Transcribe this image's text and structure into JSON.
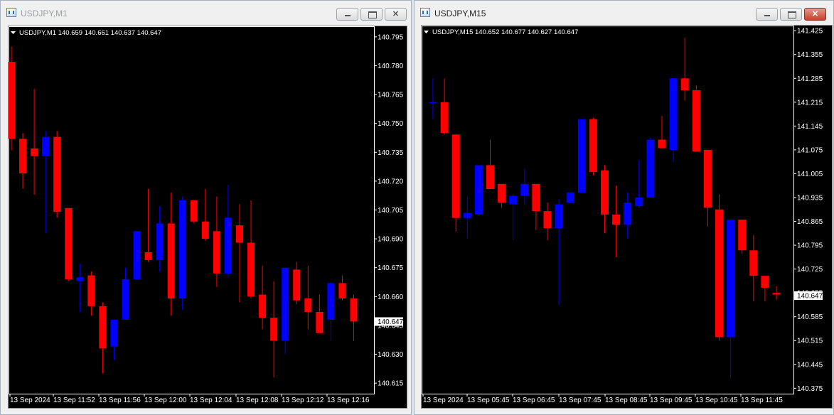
{
  "colors": {
    "bull": "#0000ff",
    "bear": "#ff0000",
    "background": "#000000",
    "axis_text": "#ffffff"
  },
  "windows": [
    {
      "title": "USDJPY,M1",
      "active": false,
      "info": "USDJPY,M1  140.659 140.661 140.637 140.647",
      "price_label": "140.647",
      "chart_data": {
        "type": "candlestick",
        "symbol": "USDJPY",
        "timeframe": "M1",
        "current_price": 140.647,
        "y_ticks": [
          "140.795",
          "140.780",
          "140.765",
          "140.750",
          "140.735",
          "140.720",
          "140.705",
          "140.690",
          "140.675",
          "140.660",
          "140.645",
          "140.630",
          "140.615"
        ],
        "ylim": [
          140.6095,
          140.8005
        ],
        "x_labels": [
          "13 Sep 2024",
          "13 Sep 11:52",
          "13 Sep 11:56",
          "13 Sep 12:00",
          "13 Sep 12:04",
          "13 Sep 12:08",
          "13 Sep 12:12",
          "13 Sep 12:16"
        ],
        "candles": [
          {
            "o": 140.782,
            "h": 140.79,
            "l": 140.736,
            "c": 140.742
          },
          {
            "o": 140.742,
            "h": 140.745,
            "l": 140.716,
            "c": 140.724
          },
          {
            "o": 140.737,
            "h": 140.768,
            "l": 140.713,
            "c": 140.733
          },
          {
            "o": 140.733,
            "h": 140.746,
            "l": 140.693,
            "c": 140.743
          },
          {
            "o": 140.743,
            "h": 140.746,
            "l": 140.701,
            "c": 140.704
          },
          {
            "o": 140.706,
            "h": 140.706,
            "l": 140.668,
            "c": 140.669
          },
          {
            "o": 140.668,
            "h": 140.677,
            "l": 140.652,
            "c": 140.67
          },
          {
            "o": 140.671,
            "h": 140.673,
            "l": 140.65,
            "c": 140.655
          },
          {
            "o": 140.655,
            "h": 140.657,
            "l": 140.62,
            "c": 140.633
          },
          {
            "o": 140.634,
            "h": 140.648,
            "l": 140.627,
            "c": 140.648
          },
          {
            "o": 140.648,
            "h": 140.675,
            "l": 140.648,
            "c": 140.669
          },
          {
            "o": 140.669,
            "h": 140.694,
            "l": 140.669,
            "c": 140.694
          },
          {
            "o": 140.683,
            "h": 140.716,
            "l": 140.678,
            "c": 140.679
          },
          {
            "o": 140.679,
            "h": 140.707,
            "l": 140.673,
            "c": 140.698
          },
          {
            "o": 140.698,
            "h": 140.714,
            "l": 140.65,
            "c": 140.659
          },
          {
            "o": 140.659,
            "h": 140.712,
            "l": 140.653,
            "c": 140.71
          },
          {
            "o": 140.71,
            "h": 140.71,
            "l": 140.698,
            "c": 140.699
          },
          {
            "o": 140.699,
            "h": 140.716,
            "l": 140.689,
            "c": 140.69
          },
          {
            "o": 140.694,
            "h": 140.712,
            "l": 140.665,
            "c": 140.672
          },
          {
            "o": 140.672,
            "h": 140.718,
            "l": 140.67,
            "c": 140.701
          },
          {
            "o": 140.697,
            "h": 140.708,
            "l": 140.657,
            "c": 140.688
          },
          {
            "o": 140.688,
            "h": 140.71,
            "l": 140.659,
            "c": 140.66
          },
          {
            "o": 140.661,
            "h": 140.676,
            "l": 140.643,
            "c": 140.649
          },
          {
            "o": 140.649,
            "h": 140.668,
            "l": 140.618,
            "c": 140.637
          },
          {
            "o": 140.637,
            "h": 140.672,
            "l": 140.63,
            "c": 140.675
          },
          {
            "o": 140.674,
            "h": 140.678,
            "l": 140.656,
            "c": 140.658
          },
          {
            "o": 140.659,
            "h": 140.676,
            "l": 140.643,
            "c": 140.652
          },
          {
            "o": 140.652,
            "h": 140.661,
            "l": 140.641,
            "c": 140.641
          },
          {
            "o": 140.648,
            "h": 140.666,
            "l": 140.637,
            "c": 140.667
          },
          {
            "o": 140.667,
            "h": 140.671,
            "l": 140.658,
            "c": 140.659
          },
          {
            "o": 140.659,
            "h": 140.661,
            "l": 140.637,
            "c": 140.647
          }
        ]
      }
    },
    {
      "title": "USDJPY,M15",
      "active": true,
      "info": "USDJPY,M15  140.652 140.677 140.627 140.647",
      "price_label": "140.647",
      "chart_data": {
        "type": "candlestick",
        "symbol": "USDJPY",
        "timeframe": "M15",
        "current_price": 140.647,
        "y_ticks": [
          "141.425",
          "141.355",
          "141.285",
          "141.215",
          "141.145",
          "141.075",
          "141.005",
          "140.935",
          "140.865",
          "140.795",
          "140.725",
          "140.655",
          "140.585",
          "140.515",
          "140.445",
          "140.375"
        ],
        "ylim": [
          140.359,
          141.44
        ],
        "x_labels": [
          "13 Sep 2024",
          "13 Sep 05:45",
          "13 Sep 06:45",
          "13 Sep 07:45",
          "13 Sep 08:45",
          "13 Sep 09:45",
          "13 Sep 10:45",
          "13 Sep 11:45"
        ],
        "candles": [
          {
            "o": 141.215,
            "h": 141.285,
            "l": 141.165,
            "c": 141.215
          },
          {
            "o": 141.215,
            "h": 141.285,
            "l": 141.12,
            "c": 141.125
          },
          {
            "o": 141.12,
            "h": 141.12,
            "l": 140.835,
            "c": 140.875
          },
          {
            "o": 140.875,
            "h": 140.94,
            "l": 140.815,
            "c": 140.89
          },
          {
            "o": 140.885,
            "h": 141.03,
            "l": 140.88,
            "c": 141.03
          },
          {
            "o": 141.03,
            "h": 141.105,
            "l": 140.96,
            "c": 140.96
          },
          {
            "o": 140.975,
            "h": 140.975,
            "l": 140.905,
            "c": 140.92
          },
          {
            "o": 140.915,
            "h": 140.945,
            "l": 140.81,
            "c": 140.94
          },
          {
            "o": 140.94,
            "h": 141.02,
            "l": 140.915,
            "c": 140.975
          },
          {
            "o": 140.975,
            "h": 140.975,
            "l": 140.84,
            "c": 140.895
          },
          {
            "o": 140.895,
            "h": 140.92,
            "l": 140.81,
            "c": 140.845
          },
          {
            "o": 140.845,
            "h": 140.93,
            "l": 140.62,
            "c": 140.915
          },
          {
            "o": 140.92,
            "h": 140.95,
            "l": 140.92,
            "c": 140.95
          },
          {
            "o": 140.95,
            "h": 141.165,
            "l": 140.95,
            "c": 141.165
          },
          {
            "o": 141.165,
            "h": 141.17,
            "l": 141.0,
            "c": 141.01
          },
          {
            "o": 141.015,
            "h": 141.03,
            "l": 140.83,
            "c": 140.885
          },
          {
            "o": 140.885,
            "h": 140.97,
            "l": 140.76,
            "c": 140.855
          },
          {
            "o": 140.855,
            "h": 140.95,
            "l": 140.815,
            "c": 140.92
          },
          {
            "o": 140.91,
            "h": 141.045,
            "l": 140.905,
            "c": 140.935
          },
          {
            "o": 140.935,
            "h": 141.11,
            "l": 140.935,
            "c": 141.105
          },
          {
            "o": 141.105,
            "h": 141.175,
            "l": 141.08,
            "c": 141.08
          },
          {
            "o": 141.075,
            "h": 141.285,
            "l": 141.04,
            "c": 141.285
          },
          {
            "o": 141.285,
            "h": 141.405,
            "l": 141.22,
            "c": 141.25
          },
          {
            "o": 141.25,
            "h": 141.265,
            "l": 141.07,
            "c": 141.07
          },
          {
            "o": 141.075,
            "h": 141.075,
            "l": 140.85,
            "c": 140.905
          },
          {
            "o": 140.9,
            "h": 140.945,
            "l": 140.515,
            "c": 140.525
          },
          {
            "o": 140.525,
            "h": 140.87,
            "l": 140.405,
            "c": 140.87
          },
          {
            "o": 140.87,
            "h": 140.87,
            "l": 140.77,
            "c": 140.78
          },
          {
            "o": 140.78,
            "h": 140.825,
            "l": 140.63,
            "c": 140.705
          },
          {
            "o": 140.705,
            "h": 140.705,
            "l": 140.63,
            "c": 140.67
          },
          {
            "o": 140.655,
            "h": 140.675,
            "l": 140.635,
            "c": 140.65
          }
        ]
      }
    }
  ]
}
